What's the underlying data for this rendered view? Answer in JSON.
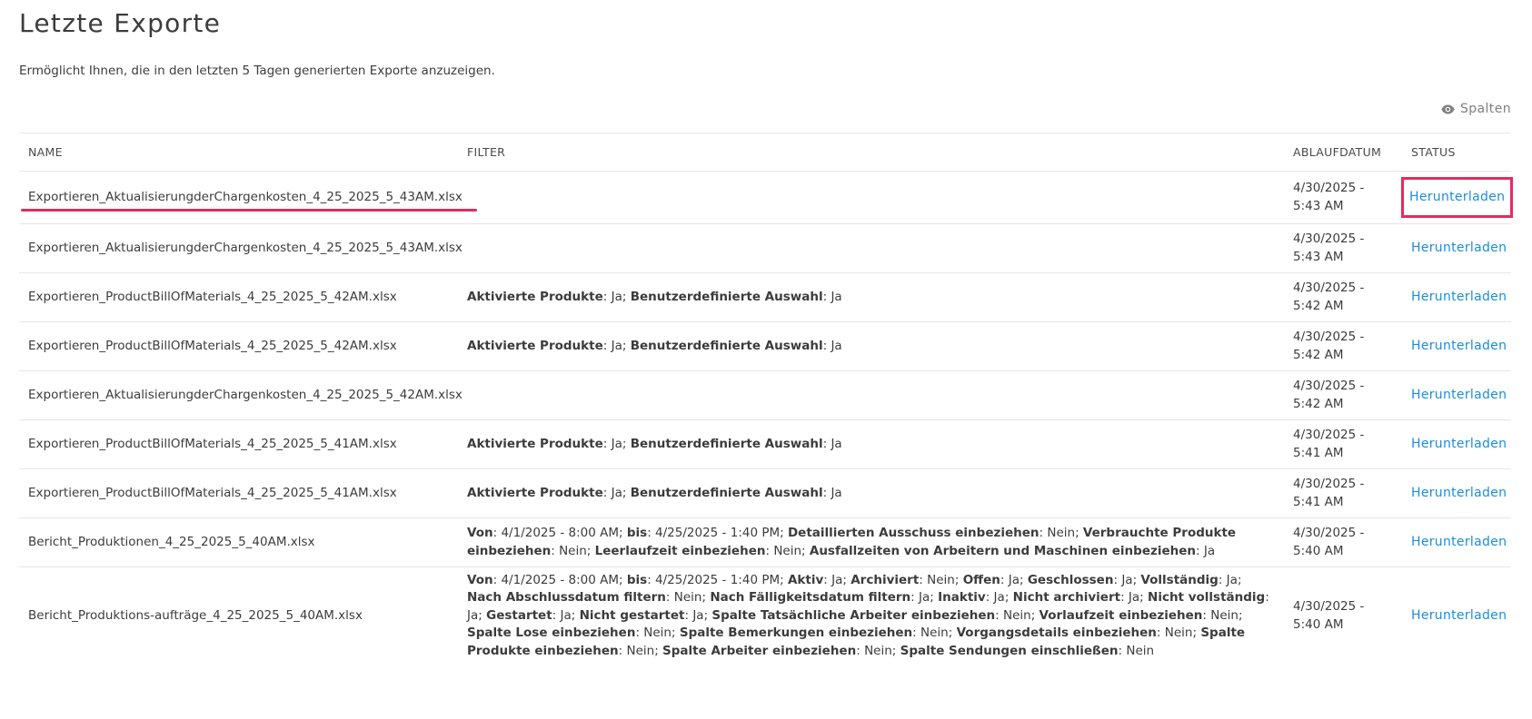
{
  "page": {
    "title": "Letzte Exporte",
    "subtitle": "Ermöglicht Ihnen, die in den letzten 5 Tagen generierten Exporte anzuzeigen.",
    "columns_button_label": "Spalten"
  },
  "table": {
    "headers": {
      "name": "NAME",
      "filter": "FILTER",
      "expiry": "ABLAUFDATUM",
      "status": "STATUS"
    },
    "rows": [
      {
        "name": "Exportieren_AktualisierungderChargenkosten_4_25_2025_5_43AM.xlsx",
        "filter": [],
        "expiry_line1": "4/30/2025 -",
        "expiry_line2": "5:43 AM",
        "status": "Herunterladen"
      },
      {
        "name": "Exportieren_AktualisierungderChargenkosten_4_25_2025_5_43AM.xlsx",
        "filter": [],
        "expiry_line1": "4/30/2025 -",
        "expiry_line2": "5:43 AM",
        "status": "Herunterladen"
      },
      {
        "name": "Exportieren_ProductBillOfMaterials_4_25_2025_5_42AM.xlsx",
        "filter": [
          {
            "label": "Aktivierte Produkte",
            "value": "Ja"
          },
          {
            "label": "Benutzerdefinierte Auswahl",
            "value": "Ja"
          }
        ],
        "expiry_line1": "4/30/2025 -",
        "expiry_line2": "5:42 AM",
        "status": "Herunterladen"
      },
      {
        "name": "Exportieren_ProductBillOfMaterials_4_25_2025_5_42AM.xlsx",
        "filter": [
          {
            "label": "Aktivierte Produkte",
            "value": "Ja"
          },
          {
            "label": "Benutzerdefinierte Auswahl",
            "value": "Ja"
          }
        ],
        "expiry_line1": "4/30/2025 -",
        "expiry_line2": "5:42 AM",
        "status": "Herunterladen"
      },
      {
        "name": "Exportieren_AktualisierungderChargenkosten_4_25_2025_5_42AM.xlsx",
        "filter": [],
        "expiry_line1": "4/30/2025 -",
        "expiry_line2": "5:42 AM",
        "status": "Herunterladen"
      },
      {
        "name": "Exportieren_ProductBillOfMaterials_4_25_2025_5_41AM.xlsx",
        "filter": [
          {
            "label": "Aktivierte Produkte",
            "value": "Ja"
          },
          {
            "label": "Benutzerdefinierte Auswahl",
            "value": "Ja"
          }
        ],
        "expiry_line1": "4/30/2025 -",
        "expiry_line2": "5:41 AM",
        "status": "Herunterladen"
      },
      {
        "name": "Exportieren_ProductBillOfMaterials_4_25_2025_5_41AM.xlsx",
        "filter": [
          {
            "label": "Aktivierte Produkte",
            "value": "Ja"
          },
          {
            "label": "Benutzerdefinierte Auswahl",
            "value": "Ja"
          }
        ],
        "expiry_line1": "4/30/2025 -",
        "expiry_line2": "5:41 AM",
        "status": "Herunterladen"
      },
      {
        "name": "Bericht_Produktionen_4_25_2025_5_40AM.xlsx",
        "filter": [
          {
            "label": "Von",
            "value": "4/1/2025 - 8:00 AM"
          },
          {
            "label": "bis",
            "value": "4/25/2025 - 1:40 PM"
          },
          {
            "label": "Detaillierten Ausschuss einbeziehen",
            "value": "Nein"
          },
          {
            "label": "Verbrauchte Produkte einbeziehen",
            "value": "Nein"
          },
          {
            "label": "Leerlaufzeit einbeziehen",
            "value": "Nein"
          },
          {
            "label": "Ausfallzeiten von Arbeitern und Maschinen einbeziehen",
            "value": "Ja"
          }
        ],
        "expiry_line1": "4/30/2025 -",
        "expiry_line2": "5:40 AM",
        "status": "Herunterladen"
      },
      {
        "name": "Bericht_Produktions-aufträge_4_25_2025_5_40AM.xlsx",
        "filter": [
          {
            "label": "Von",
            "value": "4/1/2025 - 8:00 AM"
          },
          {
            "label": "bis",
            "value": "4/25/2025 - 1:40 PM"
          },
          {
            "label": "Aktiv",
            "value": "Ja"
          },
          {
            "label": "Archiviert",
            "value": "Nein"
          },
          {
            "label": "Offen",
            "value": "Ja"
          },
          {
            "label": "Geschlossen",
            "value": "Ja"
          },
          {
            "label": "Vollständig",
            "value": "Ja"
          },
          {
            "label": "Nach Abschlussdatum filtern",
            "value": "Nein"
          },
          {
            "label": "Nach Fälligkeitsdatum filtern",
            "value": "Ja"
          },
          {
            "label": "Inaktiv",
            "value": "Ja"
          },
          {
            "label": "Nicht archiviert",
            "value": "Ja"
          },
          {
            "label": "Nicht vollständig",
            "value": "Ja"
          },
          {
            "label": "Gestartet",
            "value": "Ja"
          },
          {
            "label": "Nicht gestartet",
            "value": "Ja"
          },
          {
            "label": "Spalte Tatsächliche Arbeiter einbeziehen",
            "value": "Nein"
          },
          {
            "label": "Vorlaufzeit einbeziehen",
            "value": "Nein"
          },
          {
            "label": "Spalte Lose einbeziehen",
            "value": "Nein"
          },
          {
            "label": "Spalte Bemerkungen einbeziehen",
            "value": "Nein"
          },
          {
            "label": "Vorgangsdetails einbeziehen",
            "value": "Nein"
          },
          {
            "label": "Spalte Produkte einbeziehen",
            "value": "Nein"
          },
          {
            "label": "Spalte Arbeiter einbeziehen",
            "value": "Nein"
          },
          {
            "label": "Spalte Sendungen einschließen",
            "value": "Nein"
          }
        ],
        "expiry_line1": "4/30/2025 -",
        "expiry_line2": "5:40 AM",
        "status": "Herunterladen"
      }
    ]
  },
  "colors": {
    "link": "#1a8ed8",
    "highlight": "#e8295e",
    "border": "#e6e6e6",
    "text": "#3c3c3c"
  },
  "icons": {
    "columns_button": "eye-icon"
  }
}
